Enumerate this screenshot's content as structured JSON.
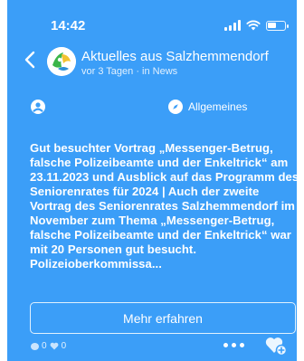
{
  "status_bar": {
    "time": "14:42"
  },
  "header": {
    "title": "Aktuelles aus Salzhemmendorf",
    "subtitle": "vor 3 Tagen · in News"
  },
  "meta": {
    "category": "Allgemeines"
  },
  "post": {
    "text": "Gut besuchter Vortrag „Messenger-Betrug, falsche Polizeibeamte und der Enkeltrick“ am 23.11.2023 und Ausblick auf das Programm des Seniorenrates für 2024 | Auch der zweite Vortrag des Seniorenrates Salzhemmendorf im November zum Thema „Messenger-Betrug, falsche Polizeibeamte und der Enkeltrick“ war mit 20 Personen gut besucht. Polizeioberkommissa..."
  },
  "actions": {
    "more_label": "Mehr erfahren"
  },
  "footer": {
    "comment_count": "0",
    "like_count": "0"
  },
  "colors": {
    "background": "#3b9ef8",
    "text": "#ffffff"
  },
  "icons": [
    "back-arrow-icon",
    "community-logo",
    "user-icon",
    "compass-icon",
    "comment-icon",
    "heart-icon",
    "more-dots-icon",
    "like-plus-icon",
    "signal-icon",
    "wifi-icon",
    "battery-icon"
  ]
}
